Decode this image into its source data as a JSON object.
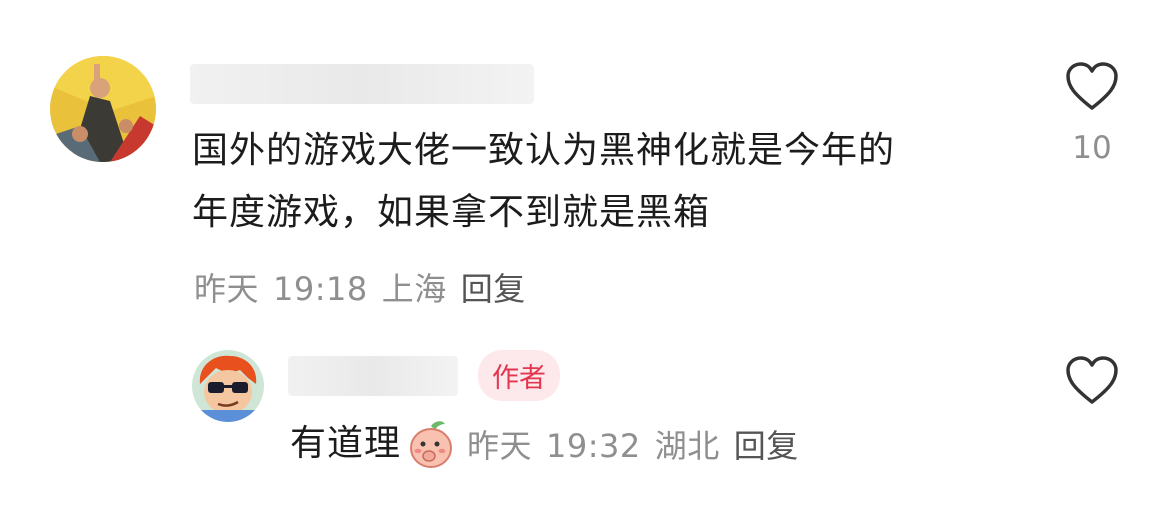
{
  "comment": {
    "text_line1": "国外的游戏大佬一致认为黑神化就是今年的",
    "text_line2": "年度游戏，如果拿不到就是黑箱",
    "date": "昨天",
    "time": "19:18",
    "location": "上海",
    "reply_label": "回复",
    "like_count": "10"
  },
  "reply": {
    "author_badge": "作者",
    "text": "有道理",
    "date": "昨天",
    "time": "19:32",
    "location": "湖北",
    "reply_label": "回复"
  },
  "colors": {
    "meta_gray": "#8f8f8f",
    "badge_bg": "#fde9ec",
    "badge_text": "#e2364f"
  },
  "icons": {
    "like": "heart-outline-icon",
    "emoji": "peach-emoji-icon"
  }
}
